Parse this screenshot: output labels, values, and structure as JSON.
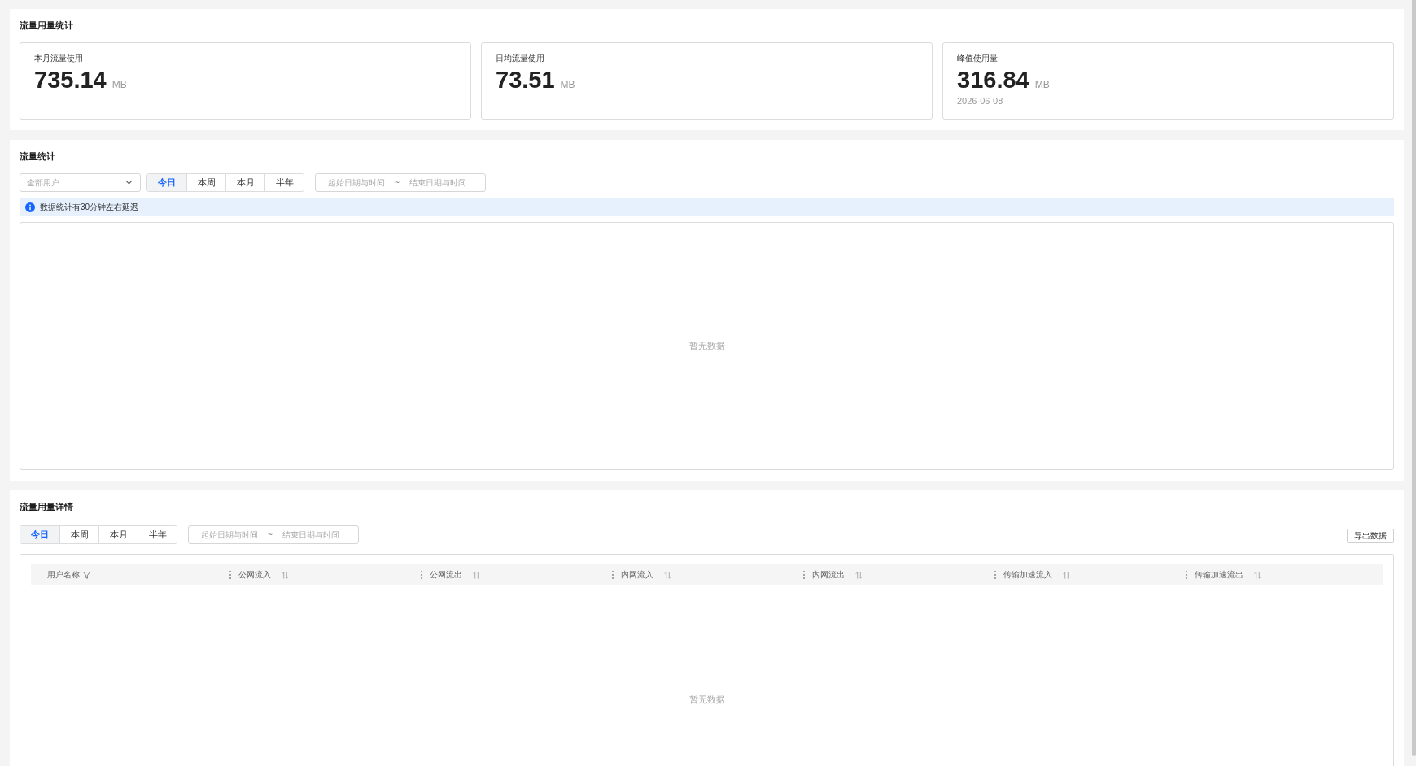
{
  "usage_summary": {
    "title": "流量用量统计",
    "cards": [
      {
        "label": "本月流量使用",
        "value": "735.14",
        "unit": "MB"
      },
      {
        "label": "日均流量使用",
        "value": "73.51",
        "unit": "MB"
      },
      {
        "label": "峰值使用量",
        "value": "316.84",
        "unit": "MB",
        "date": "2026-06-08"
      }
    ]
  },
  "traffic_stats": {
    "title": "流量统计",
    "user_filter": {
      "placeholder": "全部用户"
    },
    "ranges": [
      {
        "label": "今日",
        "selected": true
      },
      {
        "label": "本周",
        "selected": false
      },
      {
        "label": "本月",
        "selected": false
      },
      {
        "label": "半年",
        "selected": false
      }
    ],
    "date_range": {
      "start": {
        "placeholder": "起始日期与时间"
      },
      "separator": "~",
      "end": {
        "placeholder": "结束日期与时间"
      }
    },
    "notice": "数据统计有30分钟左右延迟",
    "chart": {
      "empty_text": "暂无数据"
    }
  },
  "usage_details": {
    "title": "流量用量详情",
    "ranges": [
      {
        "label": "今日",
        "selected": true
      },
      {
        "label": "本周",
        "selected": false
      },
      {
        "label": "本月",
        "selected": false
      },
      {
        "label": "半年",
        "selected": false
      }
    ],
    "date_range": {
      "start": {
        "placeholder": "起始日期与时间"
      },
      "separator": "~",
      "end": {
        "placeholder": "结束日期与时间"
      }
    },
    "export_button": "导出数据",
    "table": {
      "columns": [
        {
          "label": "用户名称",
          "kind": "filter"
        },
        {
          "label": "公网流入",
          "kind": "sort"
        },
        {
          "label": "公网流出",
          "kind": "sort"
        },
        {
          "label": "内网流入",
          "kind": "sort"
        },
        {
          "label": "内网流出",
          "kind": "sort"
        },
        {
          "label": "传输加速流入",
          "kind": "sort"
        },
        {
          "label": "传输加速流出",
          "kind": "sort"
        }
      ],
      "empty_text": "暂无数据"
    }
  }
}
